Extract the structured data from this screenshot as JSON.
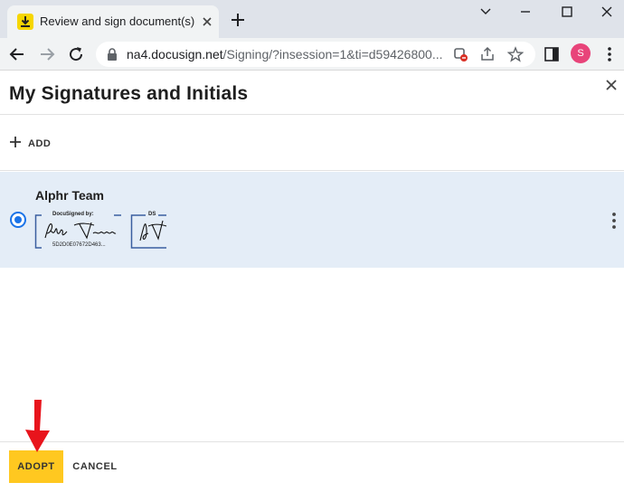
{
  "browser": {
    "tab_title": "Review and sign document(s) | Do",
    "url_host": "na4.docusign.net",
    "url_path": "/Signing/?insession=1&ti=d59426800...",
    "profile_initial": "S"
  },
  "dialog": {
    "title": "My Signatures and Initials",
    "add_label": "ADD",
    "signature": {
      "name": "Alphr Team",
      "stamp_label": "DocuSigned by:",
      "stamp_id": "5D2D0E07672D463...",
      "signature_text": "Alphr Team",
      "initials_label": "DS",
      "initials_text": "AT"
    },
    "adopt_label": "ADOPT",
    "cancel_label": "CANCEL"
  },
  "colors": {
    "accent": "#ffc820",
    "selection_bg": "#e4edf7",
    "radio": "#1a73e8",
    "stamp_border": "#3a5fa0",
    "annotation_arrow": "#e8141c"
  },
  "icons": [
    "download-icon",
    "close-icon",
    "plus-icon",
    "chevron-down-icon",
    "minimize-icon",
    "maximize-icon",
    "back-arrow-icon",
    "forward-arrow-icon",
    "reload-icon",
    "lock-icon",
    "blocked-popup-icon",
    "share-icon",
    "star-icon",
    "side-panel-icon",
    "kebab-menu-icon",
    "red-arrow-icon"
  ]
}
